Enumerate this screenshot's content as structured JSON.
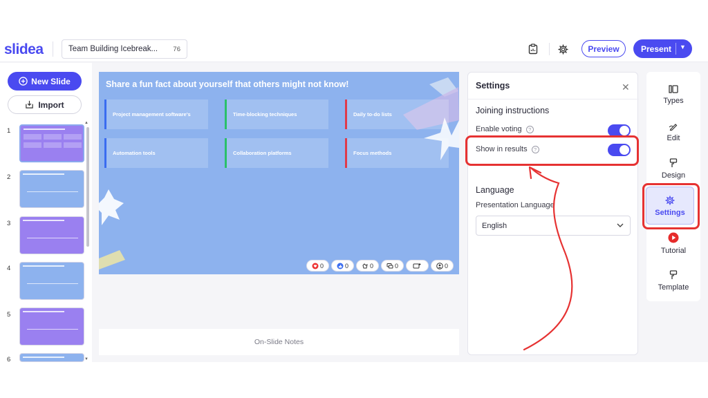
{
  "app": {
    "logo": "slidea"
  },
  "header": {
    "presentation_title": "Team Building Icebreak...",
    "participant_count": "76",
    "preview_label": "Preview",
    "present_label": "Present"
  },
  "leftbar": {
    "new_slide_label": "New Slide",
    "import_label": "Import",
    "slides": [
      {
        "num": "1",
        "bg": "#9a80f0"
      },
      {
        "num": "2",
        "bg": "#8db2ee"
      },
      {
        "num": "3",
        "bg": "#9a80f0"
      },
      {
        "num": "4",
        "bg": "#8db2ee"
      },
      {
        "num": "5",
        "bg": "#9a80f0"
      },
      {
        "num": "6",
        "bg": "#8db2ee"
      }
    ]
  },
  "slide": {
    "title": "Share a fun fact about yourself that others might not know!",
    "options": [
      {
        "label": "Project management software's",
        "color": "#3a6cf0"
      },
      {
        "label": "Time-blocking techniques",
        "color": "#2ac06a"
      },
      {
        "label": "Daily to-do lists",
        "color": "#e03a4a"
      },
      {
        "label": "Automation tools",
        "color": "#3a6cf0"
      },
      {
        "label": "Collaboration platforms",
        "color": "#2ac06a"
      },
      {
        "label": "Focus methods",
        "color": "#e03a4a"
      }
    ],
    "reactions": [
      {
        "icon": "heart-icon",
        "count": "0"
      },
      {
        "icon": "thumbs-up-icon",
        "count": "0"
      },
      {
        "icon": "clap-icon",
        "count": "0"
      },
      {
        "icon": "chat-icon",
        "count": "0"
      },
      {
        "icon": "raise-hand-icon",
        "count": ""
      },
      {
        "icon": "people-icon",
        "count": "0"
      }
    ],
    "notes_placeholder": "On-Slide Notes"
  },
  "settings": {
    "title": "Settings",
    "joining_heading": "Joining instructions",
    "enable_voting_label": "Enable voting",
    "show_results_label": "Show in results",
    "language_heading": "Language",
    "presentation_language_label": "Presentation Language",
    "language_value": "English",
    "enable_voting_on": true,
    "show_results_on": true
  },
  "rightbar": {
    "types_label": "Types",
    "edit_label": "Edit",
    "design_label": "Design",
    "settings_label": "Settings",
    "tutorial_label": "Tutorial",
    "template_label": "Template"
  },
  "colors": {
    "accent": "#4a4af0",
    "annotation": "#e63232",
    "slide_bg": "#8db2ee"
  }
}
